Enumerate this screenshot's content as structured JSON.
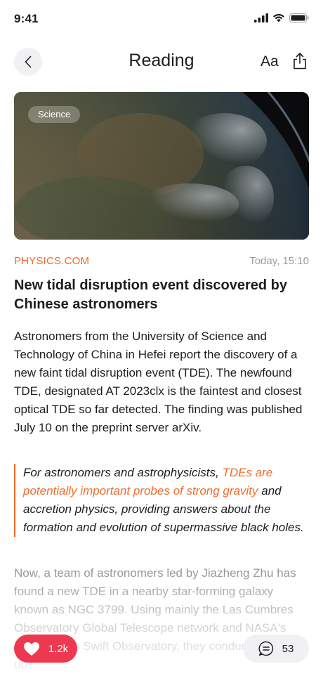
{
  "status_bar": {
    "time": "9:41",
    "icons": [
      "cellular-signal-icon",
      "wifi-icon",
      "battery-icon"
    ]
  },
  "nav": {
    "title": "Reading",
    "font_size_label": "Aa",
    "icons": [
      "chevron-left-icon",
      "share-icon"
    ]
  },
  "hero": {
    "category": "Science"
  },
  "article": {
    "source": "PHYSICS.COM",
    "timestamp": "Today, 15:10",
    "headline": "New tidal disruption event discovered by Chinese astronomers",
    "paragraph_1": "Astronomers from the University of Science and Technology of China in Hefei report the discovery of a new faint tidal disruption event (TDE). The newfound TDE, designated AT 2023clx is the faintest and closest optical TDE so far detected. The finding was published July 10 on the preprint server arXiv.",
    "quote_before": "For astronomers and astrophysicists, ",
    "quote_highlight": "TDEs are potentially important probes of strong gravity",
    "quote_after": " and accretion physics, providing answers about the formation and evolution of supermassive black holes.",
    "paragraph_2": "Now, a team of astronomers led by Jiazheng Zhu has found a new TDE in a nearby star-forming galaxy known as NGC 3799. Using mainly the Las Cumbres Observatory Global Telescope network and NASA's Neil Gehrels Swift Observatory, they conducted follow-up"
  },
  "actions": {
    "likes": "1.2k",
    "comments": "53"
  },
  "colors": {
    "accent": "#f26b2b",
    "like": "#ee3850",
    "text": "#1d1d1f",
    "muted": "#9b9ba0"
  }
}
